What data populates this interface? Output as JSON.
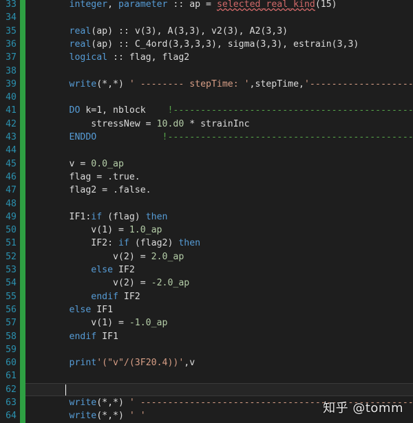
{
  "editor": {
    "lines": [
      {
        "num": "33",
        "tokens": [
          [
            "txt",
            "        "
          ],
          [
            "kw",
            "integer"
          ],
          [
            "txt",
            ", "
          ],
          [
            "kw",
            "parameter"
          ],
          [
            "txt",
            " :: ap = "
          ],
          [
            "red",
            "selected_real_kind"
          ],
          [
            "txt",
            "(15)"
          ]
        ]
      },
      {
        "num": "34",
        "tokens": []
      },
      {
        "num": "35",
        "tokens": [
          [
            "txt",
            "        "
          ],
          [
            "kw",
            "real"
          ],
          [
            "txt",
            "(ap) :: v(3), A(3,3), v2(3), A2(3,3)"
          ]
        ]
      },
      {
        "num": "36",
        "tokens": [
          [
            "txt",
            "        "
          ],
          [
            "kw",
            "real"
          ],
          [
            "txt",
            "(ap) :: C_4ord(3,3,3,3), sigma(3,3), estrain(3,3)"
          ]
        ]
      },
      {
        "num": "37",
        "tokens": [
          [
            "txt",
            "        "
          ],
          [
            "kw",
            "logical"
          ],
          [
            "txt",
            " :: flag, flag2"
          ]
        ]
      },
      {
        "num": "38",
        "tokens": []
      },
      {
        "num": "39",
        "tokens": [
          [
            "txt",
            "        "
          ],
          [
            "kw",
            "write"
          ],
          [
            "txt",
            "(*,*) "
          ],
          [
            "str",
            "' -------- stepTime: '"
          ],
          [
            "txt",
            ",stepTime,"
          ],
          [
            "str",
            "'------------------- '"
          ]
        ]
      },
      {
        "num": "40",
        "tokens": []
      },
      {
        "num": "41",
        "tokens": [
          [
            "txt",
            "        "
          ],
          [
            "kw",
            "DO"
          ],
          [
            "txt",
            " k=1, nblock    "
          ],
          [
            "cmt",
            "!---------------------------------------------"
          ]
        ]
      },
      {
        "num": "42",
        "tokens": [
          [
            "txt",
            "            stressNew = "
          ],
          [
            "num",
            "10.d0"
          ],
          [
            "txt",
            " * strainInc"
          ]
        ]
      },
      {
        "num": "43",
        "tokens": [
          [
            "txt",
            "        "
          ],
          [
            "kw",
            "ENDDO"
          ],
          [
            "txt",
            "            "
          ],
          [
            "cmt",
            "!---------------------------------------------"
          ]
        ]
      },
      {
        "num": "44",
        "tokens": []
      },
      {
        "num": "45",
        "tokens": [
          [
            "txt",
            "        v = "
          ],
          [
            "num",
            "0.0_ap"
          ]
        ]
      },
      {
        "num": "46",
        "tokens": [
          [
            "txt",
            "        flag = .true."
          ]
        ]
      },
      {
        "num": "47",
        "tokens": [
          [
            "txt",
            "        flag2 = .false."
          ]
        ]
      },
      {
        "num": "48",
        "tokens": []
      },
      {
        "num": "49",
        "tokens": [
          [
            "lbl",
            "        IF1:"
          ],
          [
            "kw",
            "if"
          ],
          [
            "txt",
            " (flag) "
          ],
          [
            "kw",
            "then"
          ]
        ]
      },
      {
        "num": "50",
        "tokens": [
          [
            "txt",
            "            v(1) = "
          ],
          [
            "num",
            "1.0_ap"
          ]
        ]
      },
      {
        "num": "51",
        "tokens": [
          [
            "lbl",
            "            IF2: "
          ],
          [
            "kw",
            "if"
          ],
          [
            "txt",
            " (flag2) "
          ],
          [
            "kw",
            "then"
          ]
        ]
      },
      {
        "num": "52",
        "tokens": [
          [
            "txt",
            "                v(2) = "
          ],
          [
            "num",
            "2.0_ap"
          ]
        ]
      },
      {
        "num": "53",
        "tokens": [
          [
            "txt",
            "            "
          ],
          [
            "kw",
            "else"
          ],
          [
            "txt",
            " IF2"
          ]
        ]
      },
      {
        "num": "54",
        "tokens": [
          [
            "txt",
            "                v(2) = "
          ],
          [
            "num",
            "-2.0_ap"
          ]
        ]
      },
      {
        "num": "55",
        "tokens": [
          [
            "txt",
            "            "
          ],
          [
            "kw",
            "endif"
          ],
          [
            "txt",
            " IF2"
          ]
        ]
      },
      {
        "num": "56",
        "tokens": [
          [
            "txt",
            "        "
          ],
          [
            "kw",
            "else"
          ],
          [
            "txt",
            " IF1"
          ]
        ]
      },
      {
        "num": "57",
        "tokens": [
          [
            "txt",
            "            v(1) = "
          ],
          [
            "num",
            "-1.0_ap"
          ]
        ]
      },
      {
        "num": "58",
        "tokens": [
          [
            "txt",
            "        "
          ],
          [
            "kw",
            "endif"
          ],
          [
            "txt",
            " IF1"
          ]
        ]
      },
      {
        "num": "59",
        "tokens": []
      },
      {
        "num": "60",
        "tokens": [
          [
            "txt",
            "        "
          ],
          [
            "kw",
            "print"
          ],
          [
            "str",
            "'(\"v\"/(3F20.4))'"
          ],
          [
            "txt",
            ",v"
          ]
        ]
      },
      {
        "num": "61",
        "tokens": []
      },
      {
        "num": "62",
        "tokens": [],
        "current": true
      },
      {
        "num": "63",
        "tokens": [
          [
            "txt",
            "        "
          ],
          [
            "kw",
            "write"
          ],
          [
            "txt",
            "(*,*) "
          ],
          [
            "str",
            "' -----------------------------------------------------'"
          ]
        ]
      },
      {
        "num": "64",
        "tokens": [
          [
            "txt",
            "        "
          ],
          [
            "kw",
            "write"
          ],
          [
            "txt",
            "(*,*) "
          ],
          [
            "str",
            "' '"
          ]
        ]
      }
    ]
  },
  "watermark": {
    "text": "知乎 @tomm"
  }
}
